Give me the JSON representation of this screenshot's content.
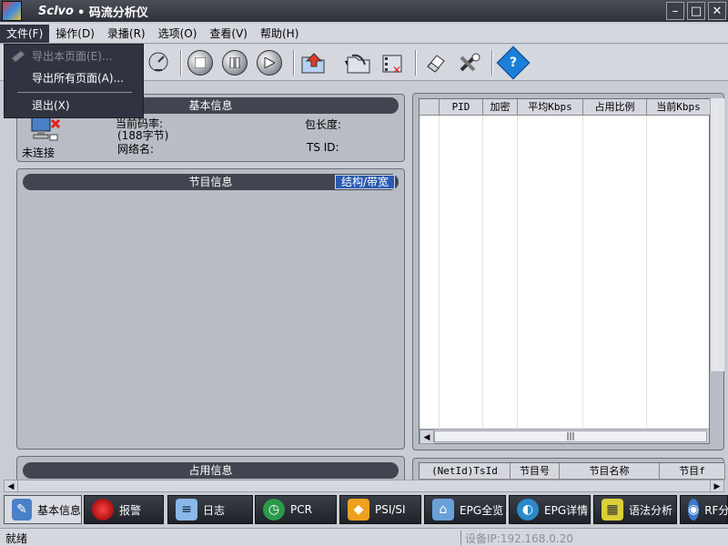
{
  "window": {
    "brand": "Sclvo",
    "title": "• 码流分析仪"
  },
  "menu": [
    "文件(F)",
    "操作(D)",
    "录播(R)",
    "选项(O)",
    "查看(V)",
    "帮助(H)"
  ],
  "file_menu": {
    "items": [
      "导出本页面(E)...",
      "导出所有页面(A)...",
      "退出(X)"
    ]
  },
  "basic_info": {
    "title": "基本信息",
    "status": "未连接",
    "bitrate_label": "当前码率:",
    "packet_bytes": "(188字节)",
    "network_name_label": "网络名:",
    "packet_length_label": "包长度:",
    "ts_id_label": "TS ID:"
  },
  "program_info": {
    "title": "节目信息",
    "button": "结构/带宽"
  },
  "occupy_info": {
    "title": "占用信息"
  },
  "pid_table": {
    "columns": [
      "PID",
      "加密",
      "平均Kbps",
      "占用比例",
      "当前Kbps"
    ]
  },
  "service_table": {
    "columns": [
      "(NetId)TsId",
      "节目号",
      "节目名称",
      "节目f"
    ]
  },
  "tabs": [
    "基本信息",
    "报警",
    "日志",
    "PCR",
    "PSI/SI",
    "EPG全览",
    "EPG详情",
    "语法分析",
    "RF分"
  ],
  "status": {
    "text": "就绪",
    "device_ip": "设备IP:192.168.0.20"
  },
  "colors": {
    "accent": "#2a5ab0",
    "panel_header": "#40454f",
    "menu_dark": "#2f3440"
  }
}
